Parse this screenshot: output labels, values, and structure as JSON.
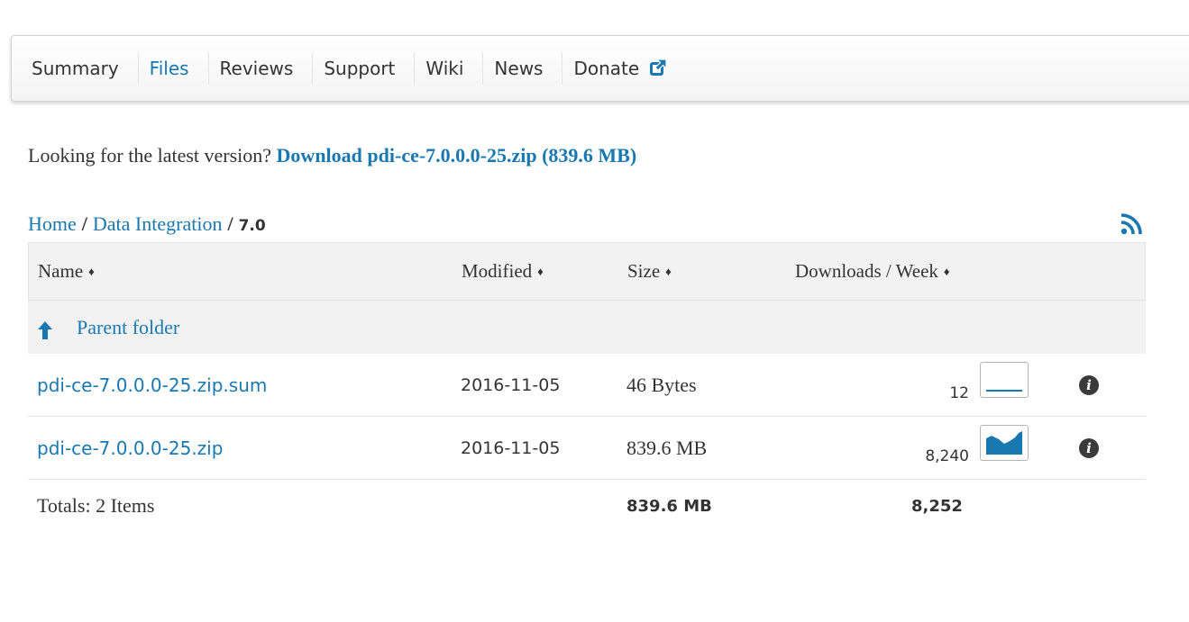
{
  "tabs": [
    {
      "label": "Summary",
      "active": false
    },
    {
      "label": "Files",
      "active": true
    },
    {
      "label": "Reviews",
      "active": false
    },
    {
      "label": "Support",
      "active": false
    },
    {
      "label": "Wiki",
      "active": false
    },
    {
      "label": "News",
      "active": false
    },
    {
      "label": "Donate",
      "active": false,
      "icon": "external-link-icon"
    }
  ],
  "latest": {
    "prompt": "Looking for the latest version?",
    "link_label": "Download pdi-ce-7.0.0.0-25.zip (839.6 MB)"
  },
  "breadcrumb": {
    "home": "Home",
    "sep": "/",
    "section": "Data Integration",
    "current": "7.0"
  },
  "table": {
    "headers": {
      "name": "Name",
      "modified": "Modified",
      "size": "Size",
      "downloads": "Downloads / Week",
      "sort_glyph": "♦"
    },
    "parent_label": "Parent folder",
    "rows": [
      {
        "name": "pdi-ce-7.0.0.0-25.zip.sum",
        "modified": "2016-11-05",
        "size": "46 Bytes",
        "downloads": "12"
      },
      {
        "name": "pdi-ce-7.0.0.0-25.zip",
        "modified": "2016-11-05",
        "size": "839.6 MB",
        "downloads": "8,240"
      }
    ],
    "totals": {
      "label": "Totals: 2 Items",
      "size": "839.6 MB",
      "downloads": "8,252"
    }
  },
  "colors": {
    "link": "#1a78b0",
    "text": "#333333",
    "header_bg": "#f2f2f2",
    "info_icon": "#3a3a3a"
  },
  "icons": [
    "external-link-icon",
    "rss-icon",
    "up-arrow-icon",
    "info-icon",
    "sparkline-chart"
  ]
}
